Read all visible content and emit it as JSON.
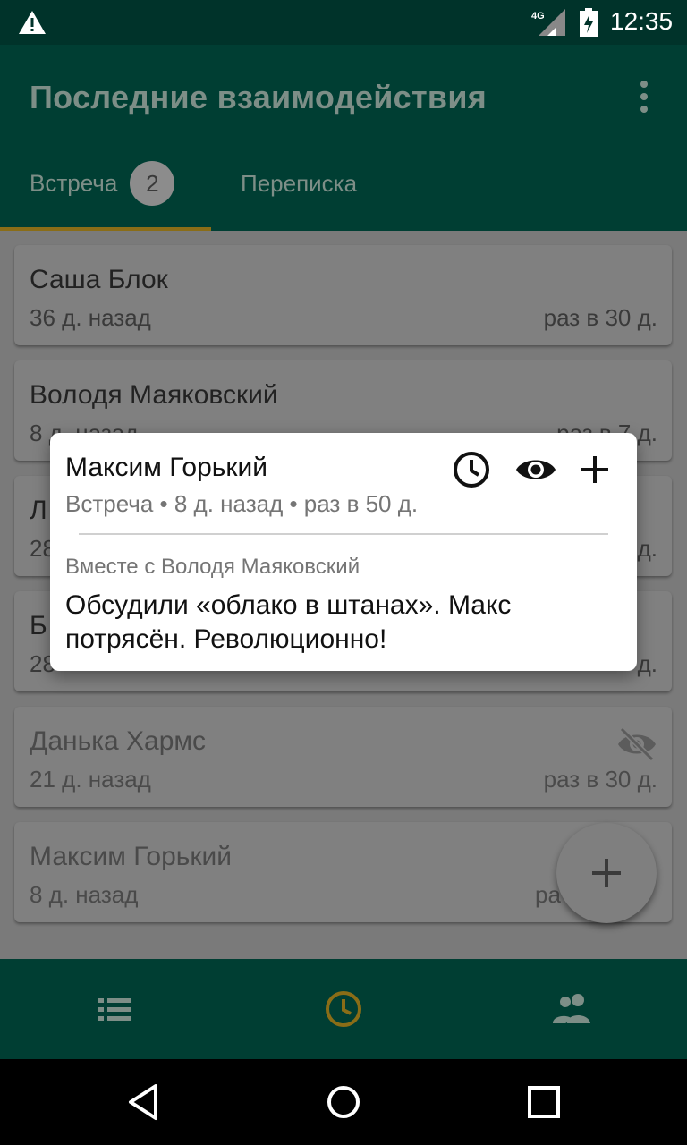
{
  "status_bar": {
    "time": "12:35",
    "network": "4G",
    "icons": [
      "warning-icon",
      "signal-icon",
      "battery-charging-icon"
    ]
  },
  "app_bar": {
    "title": "Последние взаимодействия",
    "menu_icon": "more-vert-icon"
  },
  "tabs": [
    {
      "label": "Встреча",
      "badge": "2",
      "selected": true
    },
    {
      "label": "Переписка",
      "selected": false
    }
  ],
  "contacts": [
    {
      "name": "Саша Блок",
      "ago": "36 д. назад",
      "frequency": "раз в 30 д."
    },
    {
      "name": "Володя Маяковский",
      "ago": "8 д. назад",
      "frequency": "раз в 7 д."
    },
    {
      "name": "Л",
      "ago": "28",
      "frequency": "д."
    },
    {
      "name": "Б",
      "ago": "28",
      "frequency": "д."
    },
    {
      "name": "Данька Хармс",
      "ago": "21 д. назад",
      "frequency": "раз в 30 д.",
      "hidden": true
    },
    {
      "name": "Максим Горький",
      "ago": "8 д. назад",
      "frequency": "ра"
    }
  ],
  "popup": {
    "name": "Максим Горький",
    "meta": "Встреча • 8 д. назад • раз в 50 д.",
    "with": "Вместе с Володя Маяковский",
    "note": "Обсудили «облако в штанах». Макс потрясён. Революционно!",
    "actions": [
      "clock-icon",
      "eye-icon",
      "plus-icon"
    ]
  },
  "fab": {
    "icon": "plus-icon"
  },
  "bottom_nav": {
    "items": [
      "list-icon",
      "recent-icon",
      "people-icon"
    ],
    "selected": "recent-icon"
  },
  "colors": {
    "primary_dark": "#00332a",
    "primary": "#003e33",
    "accent": "#8a6d17",
    "scrim": "#7a7a7a"
  }
}
